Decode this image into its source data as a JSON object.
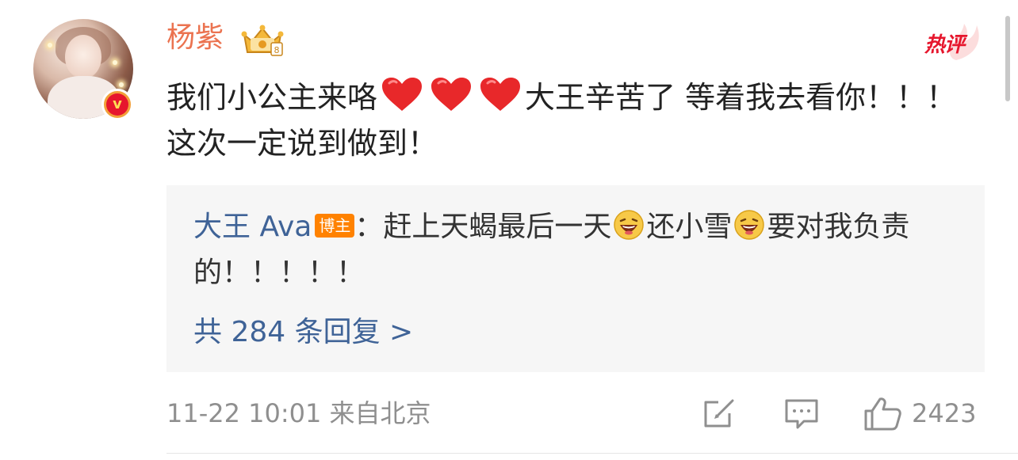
{
  "comment": {
    "author": "杨紫",
    "hot_label": "热评",
    "text_before_hearts": "我们小公主来咯",
    "heart_emoji": "heart-emoji",
    "text_after_hearts": "大王辛苦了 等着我去看你！！！ 这次一定说到做到！",
    "timestamp": "11-22 10:01",
    "source": "来自北京",
    "like_count": "2423"
  },
  "reply": {
    "author": "大王 Ava",
    "badge": "博主",
    "part1": "：赶上天蝎最后一天",
    "part2": "还小雪",
    "part3": "要对我负责的！！！！！",
    "more": "共 284 条回复 >",
    "emoji": "laughing-emoji"
  },
  "colors": {
    "author": "#eb7350",
    "link": "#3f6397",
    "hot": "#e6162d",
    "meta": "#8f8f8f",
    "reply_bg": "#f6f6f6"
  }
}
